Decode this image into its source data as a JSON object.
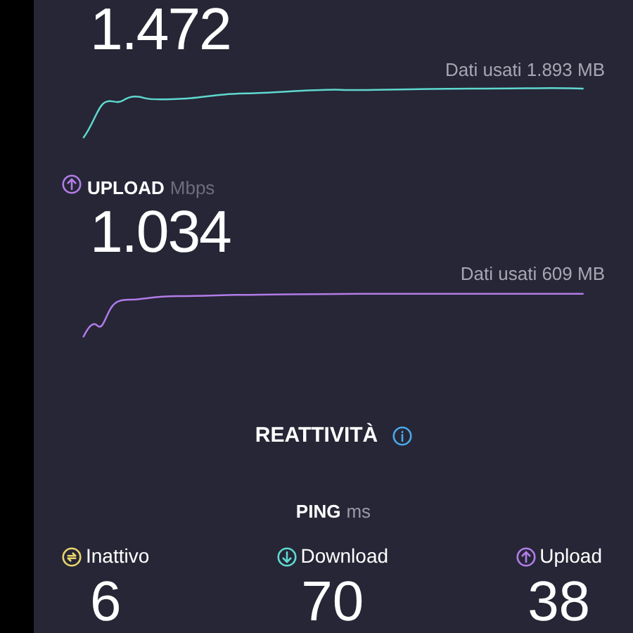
{
  "download": {
    "value": "1.472",
    "data_used": "Dati usati 1.893 MB"
  },
  "upload": {
    "label": "UPLOAD",
    "unit": "Mbps",
    "value": "1.034",
    "data_used": "Dati usati 609 MB"
  },
  "responsiveness": {
    "title": "REATTIVITÀ"
  },
  "ping": {
    "label": "PING",
    "unit": "ms",
    "items": [
      {
        "kind": "idle",
        "label": "Inattivo",
        "value": "6",
        "color": "#e8d56a"
      },
      {
        "kind": "down",
        "label": "Download",
        "value": "70",
        "color": "#5fd8d0"
      },
      {
        "kind": "up",
        "label": "Upload",
        "value": "38",
        "color": "#b27ce8"
      }
    ]
  }
}
